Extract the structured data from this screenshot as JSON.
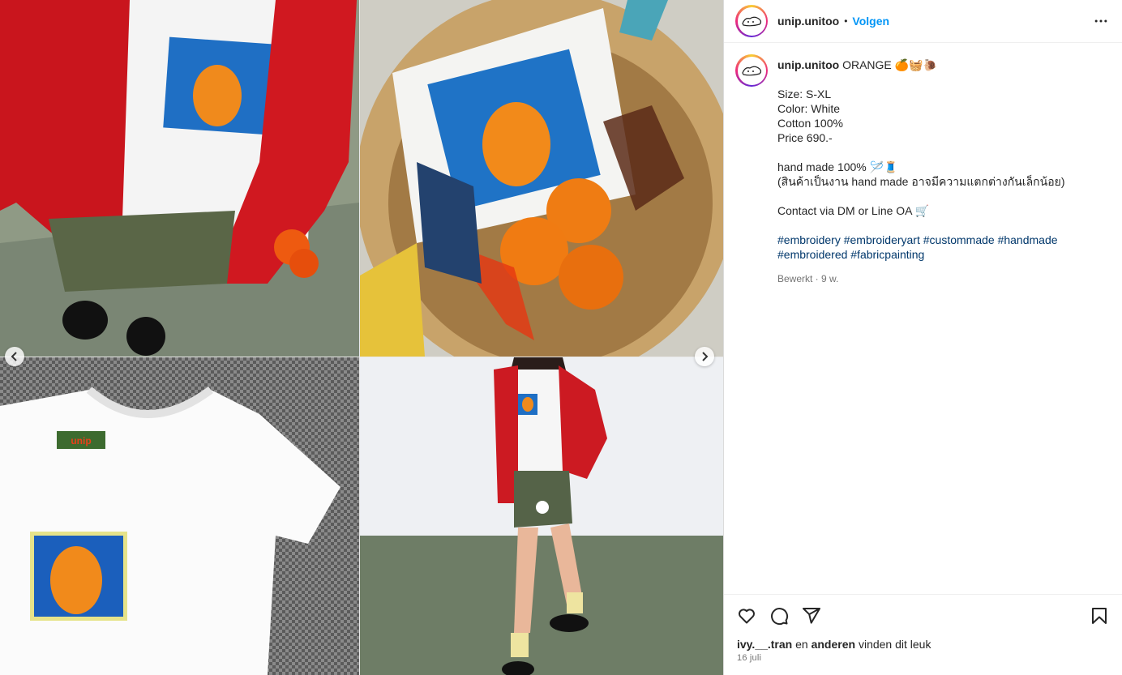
{
  "post": {
    "username": "unip.unitoo",
    "dot": "•",
    "follow_label": "Volgen",
    "caption": {
      "title": "ORANGE 🍊🧺🐌",
      "lines": [
        "Size: S-XL",
        "Color: White",
        "Cotton 100%",
        "Price 690.-",
        "",
        "hand made 100% 🪡🧵",
        "(สินค้าเป็นงาน hand made อาจมีความแตกต่างกันเล็กน้อย)",
        "",
        "Contact via DM or Line OA 🛒",
        ""
      ],
      "hashtags_line1": "#embroidery #embroideryart #custommade #handmade",
      "hashtags_line2": "#embroidered #fabricpainting"
    },
    "edited_meta": "Bewerkt · 9 w.",
    "likes": {
      "user": "ivy.__.tran",
      "joiner": " en ",
      "others": "anderen",
      "suffix": " vinden dit leuk"
    },
    "date": "16 juli"
  },
  "icons": {
    "more": "more-options-icon",
    "like": "heart-icon",
    "comment": "comment-icon",
    "share": "share-icon",
    "save": "bookmark-icon",
    "prev": "chevron-left-icon",
    "next": "chevron-right-icon"
  },
  "colors": {
    "follow": "#0095f6",
    "hashtag": "#00376b",
    "muted": "#737373"
  }
}
